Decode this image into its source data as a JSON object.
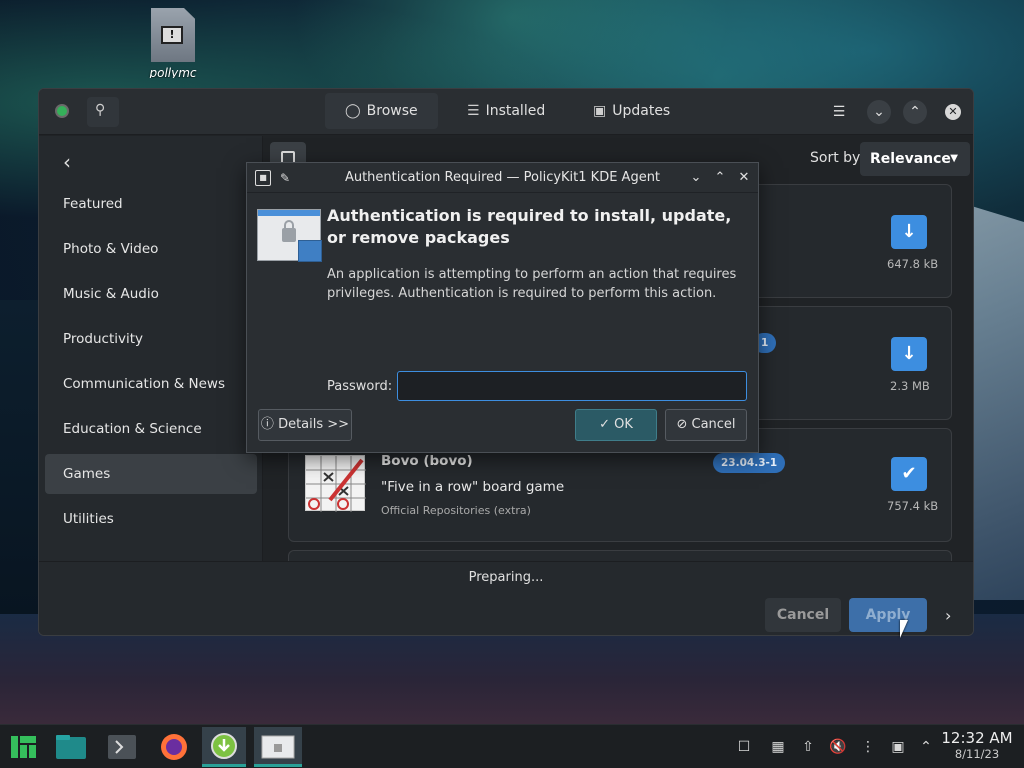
{
  "desktop": {
    "icon_label": "pollymc"
  },
  "app": {
    "tabs": [
      {
        "label": "Browse",
        "icon": "globe-icon"
      },
      {
        "label": "Installed",
        "icon": "list-icon"
      },
      {
        "label": "Updates",
        "icon": "folder-icon"
      }
    ],
    "sidebar": {
      "items": [
        {
          "label": "Featured"
        },
        {
          "label": "Photo & Video"
        },
        {
          "label": "Music & Audio"
        },
        {
          "label": "Productivity"
        },
        {
          "label": "Communication & News"
        },
        {
          "label": "Education & Science"
        },
        {
          "label": "Games"
        },
        {
          "label": "Utilities"
        }
      ],
      "active_index": 6
    },
    "sort": {
      "label": "Sort by",
      "value": "Relevance"
    },
    "packages": [
      {
        "size": "647.8 kB",
        "action": "download"
      },
      {
        "version_partial": "1",
        "size": "2.3 MB",
        "action": "download"
      },
      {
        "title": "Bovo (bovo)",
        "description": "\"Five in a row\" board game",
        "repo": "Official Repositories (extra)",
        "version": "23.04.3-1",
        "size": "757.4 kB",
        "action": "selected"
      }
    ],
    "status": "Preparing...",
    "buttons": {
      "cancel": "Cancel",
      "apply": "Apply"
    }
  },
  "dialog": {
    "title": "Authentication Required — PolicyKit1 KDE Agent",
    "heading": "Authentication is required to install, update, or remove packages",
    "body": "An application is attempting to perform an action that requires privileges. Authentication is required to perform this action.",
    "password_label": "Password:",
    "password_value": "",
    "details_label": "Details >>",
    "ok_label": "OK",
    "cancel_label": "Cancel"
  },
  "taskbar": {
    "time": "12:32 AM",
    "date": "8/11/23"
  },
  "colors": {
    "accent": "#3d8ee0",
    "panel": "#202326",
    "teal": "#2aa198"
  }
}
